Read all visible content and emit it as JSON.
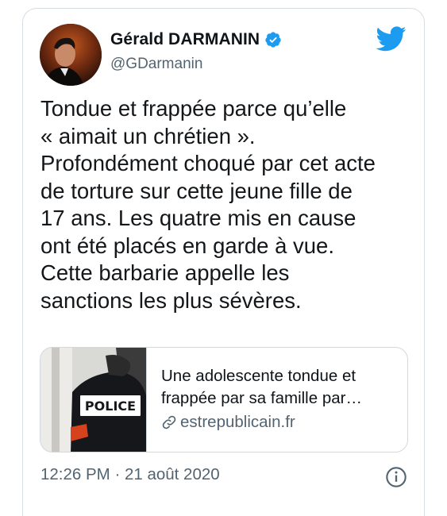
{
  "tweet": {
    "author_name": "Gérald DARMANIN",
    "handle": "@GDarmanin",
    "text_lines": [
      "Tondue et frappée parce qu’elle",
      "« aimait un chrétien ».",
      "Profondément choqué par cet acte",
      "de torture sur cette jeune fille de",
      "17 ans. Les quatre mis en cause",
      "ont été placés en garde à vue.",
      "Cette barbarie appelle les",
      "sanctions les plus sévères."
    ],
    "timestamp": "12:26 PM · 21 août 2020"
  },
  "link_card": {
    "title_lines": [
      "Une adolescente tondue et",
      "frappée par sa famille par…"
    ],
    "domain": "estrepublicain.fr",
    "thumbnail_text": "POLICE"
  },
  "colors": {
    "brand": "#1d9bf0",
    "secondary_text": "#536471",
    "border": "#cfd9de"
  },
  "icons": [
    "verified-badge-icon",
    "twitter-bird-icon",
    "link-icon",
    "info-icon"
  ]
}
